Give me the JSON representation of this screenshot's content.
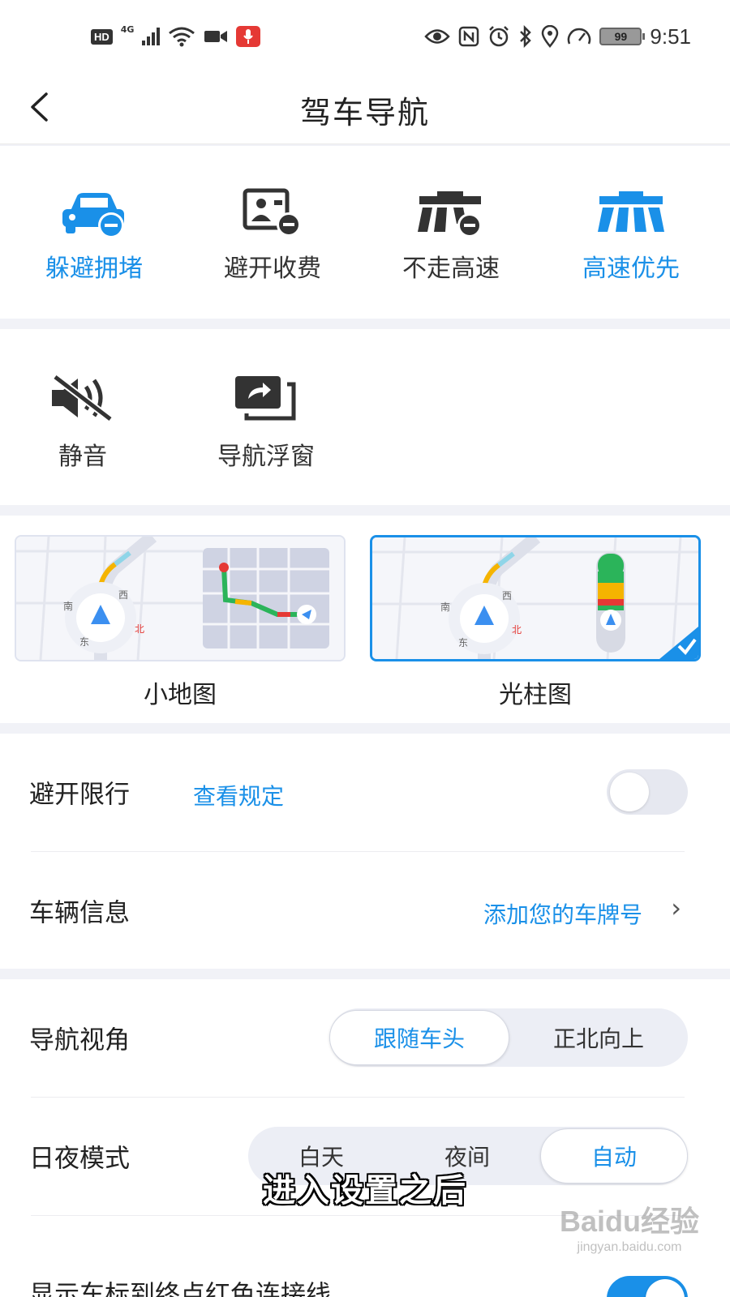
{
  "status_bar": {
    "hd": "HD",
    "network": "4G",
    "battery": "99",
    "time": "9:51",
    "icons": [
      "hd-icon",
      "signal-icon",
      "wifi-icon",
      "camera-icon",
      "microphone-icon",
      "eye-icon",
      "nfc-icon",
      "alarm-icon",
      "bluetooth-icon",
      "location-icon",
      "speedometer-icon",
      "battery-icon"
    ]
  },
  "header": {
    "title": "驾车导航",
    "back_icon": "back-arrow-icon"
  },
  "route_preferences": [
    {
      "label": "躲避拥堵",
      "icon": "car-avoid-icon",
      "active": true
    },
    {
      "label": "避开收费",
      "icon": "toll-avoid-icon",
      "active": false
    },
    {
      "label": "不走高速",
      "icon": "highway-avoid-icon",
      "active": false
    },
    {
      "label": "高速优先",
      "icon": "highway-icon",
      "active": true
    }
  ],
  "tools": [
    {
      "label": "静音",
      "icon": "mute-icon"
    },
    {
      "label": "导航浮窗",
      "icon": "floating-window-icon"
    }
  ],
  "map_styles": {
    "mini_map": {
      "label": "小地图",
      "compass": [
        "南",
        "西",
        "东",
        "北"
      ]
    },
    "light_bar": {
      "label": "光柱图",
      "compass": [
        "南",
        "西",
        "东",
        "北"
      ],
      "selected": true
    }
  },
  "settings": {
    "avoid_restriction": {
      "title": "避开限行",
      "link": "查看规定",
      "enabled": false
    },
    "vehicle_info": {
      "title": "车辆信息",
      "action": "添加您的车牌号",
      "chevron": "›"
    },
    "nav_view": {
      "title": "导航视角",
      "options": [
        "跟随车头",
        "正北向上"
      ],
      "selected": "跟随车头"
    },
    "day_night": {
      "title": "日夜模式",
      "options": [
        "白天",
        "夜间",
        "自动"
      ],
      "selected": "自动"
    },
    "show_line": {
      "title": "显示车标到终点红色连接线",
      "enabled": true
    }
  },
  "overlay": {
    "caption": "进入设置之后",
    "watermark_line1": "Baidu经验",
    "watermark_line2": "jingyan.baidu.com"
  },
  "colors": {
    "accent": "#1a90e8",
    "traffic_green": "#2bb45a",
    "traffic_yellow": "#f5b400",
    "traffic_red": "#e53935"
  }
}
